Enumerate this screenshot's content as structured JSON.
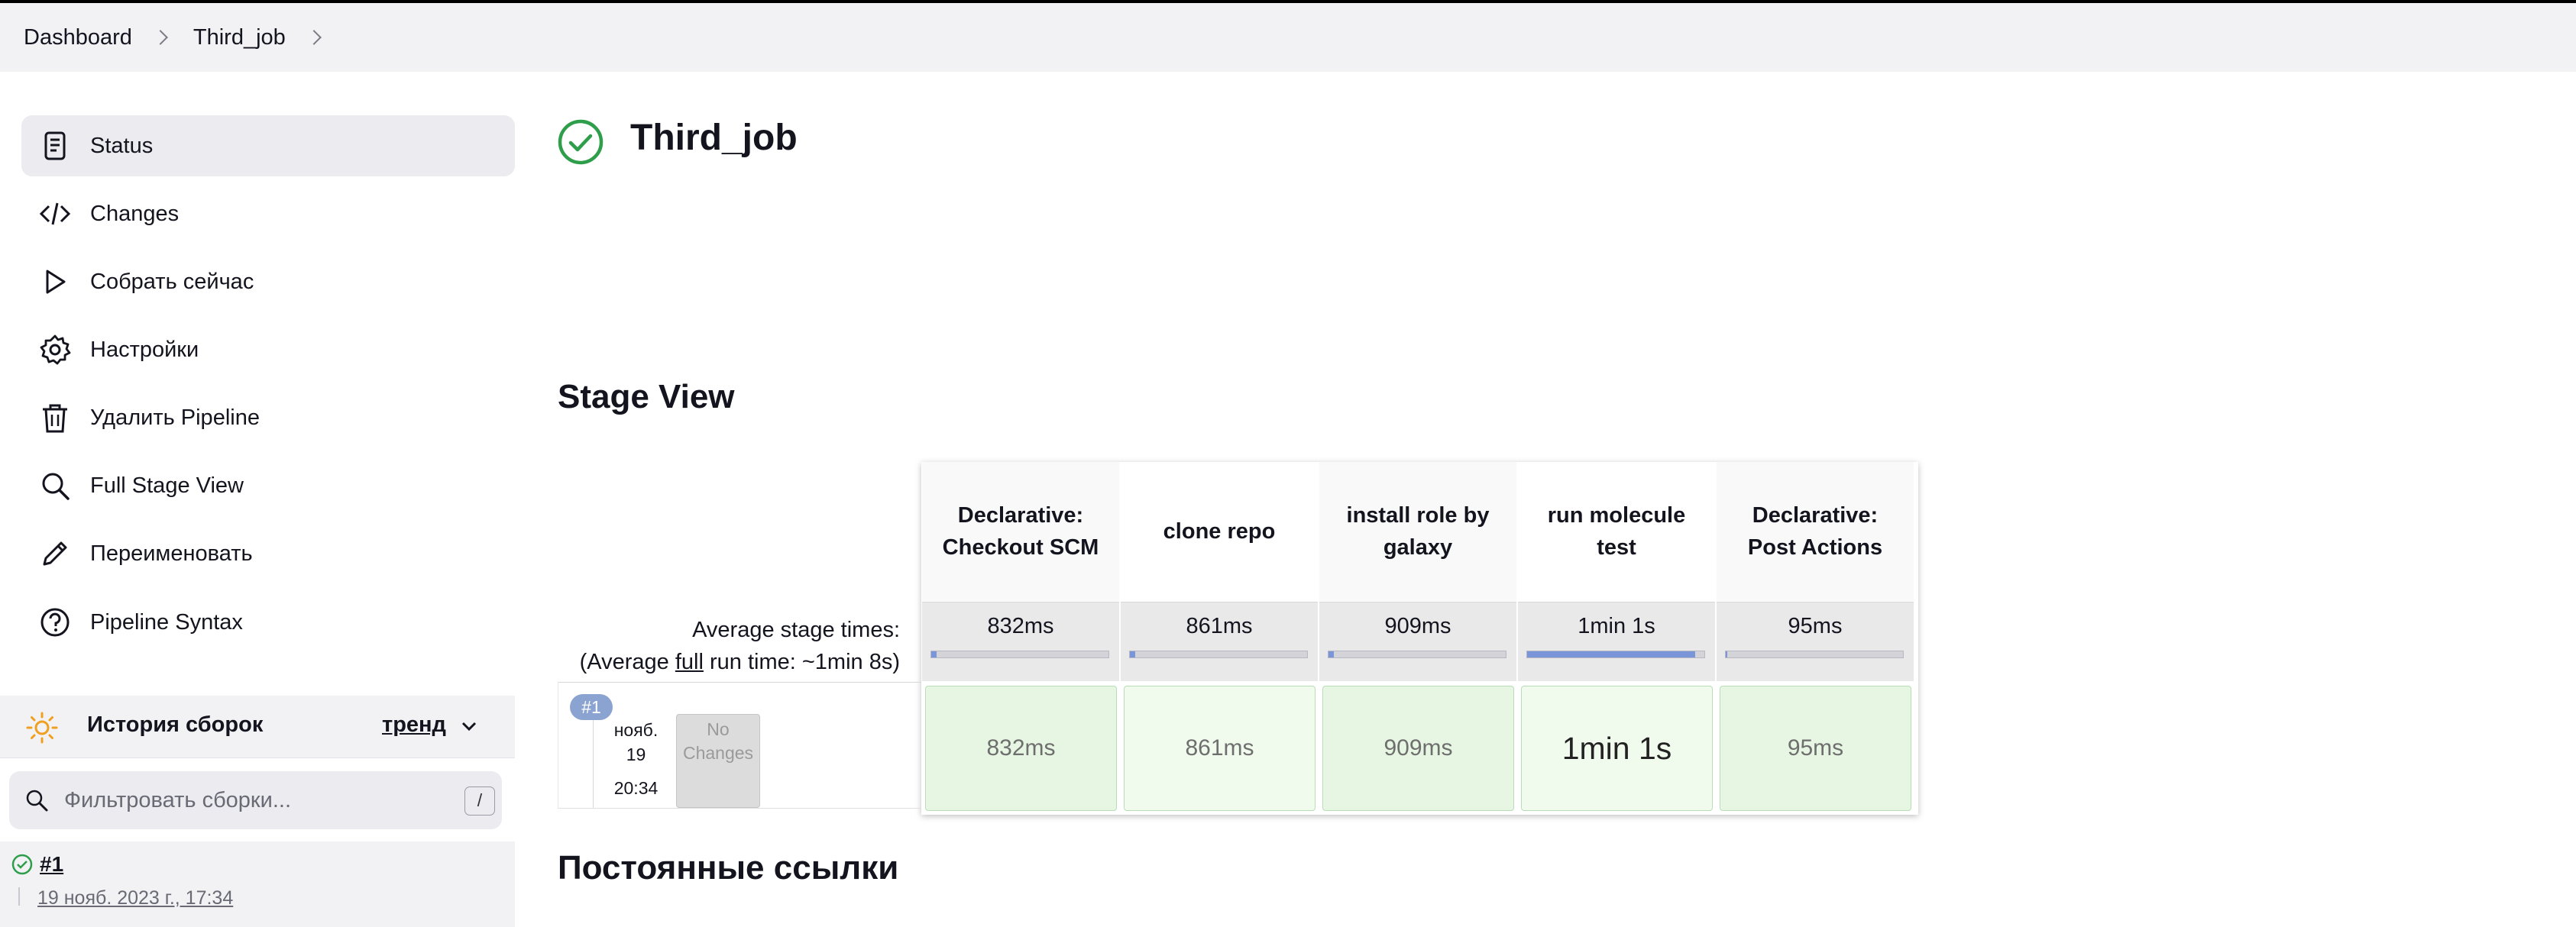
{
  "breadcrumb": {
    "items": [
      "Dashboard",
      "Third_job"
    ]
  },
  "sidebar": {
    "items": [
      {
        "label": "Status",
        "icon": "document-icon"
      },
      {
        "label": "Changes",
        "icon": "code-icon"
      },
      {
        "label": "Собрать сейчас",
        "icon": "play-icon"
      },
      {
        "label": "Настройки",
        "icon": "gear-icon"
      },
      {
        "label": "Удалить Pipeline",
        "icon": "trash-icon"
      },
      {
        "label": "Full Stage View",
        "icon": "search-icon"
      },
      {
        "label": "Переименовать",
        "icon": "pencil-icon"
      },
      {
        "label": "Pipeline Syntax",
        "icon": "help-icon"
      }
    ],
    "history": {
      "title": "История сборок",
      "trend": "тренд",
      "filter_placeholder": "Фильтровать сборки...",
      "filter_shortcut": "/",
      "builds": [
        {
          "number": "#1",
          "date": "19 нояб. 2023 г., 17:34",
          "status": "success"
        }
      ]
    }
  },
  "main": {
    "title": "Third_job",
    "status_color": "#2e9e4a",
    "stage_view": {
      "heading": "Stage View",
      "avg_label_line1": "Average stage times:",
      "avg_label_pre": "(Average ",
      "avg_label_link": "full",
      "avg_label_post": " run time: ~1min 8s)",
      "stages": [
        {
          "name": "Declarative: Checkout SCM",
          "avg": "832ms",
          "run": "832ms",
          "avg_fraction": 0.03
        },
        {
          "name": "clone repo",
          "avg": "861ms",
          "run": "861ms",
          "avg_fraction": 0.03
        },
        {
          "name": "install role by galaxy",
          "avg": "909ms",
          "run": "909ms",
          "avg_fraction": 0.03
        },
        {
          "name": "run molecule test",
          "avg": "1min 1s",
          "run": "1min 1s",
          "avg_fraction": 0.95
        },
        {
          "name": "Declarative: Post Actions",
          "avg": "95ms",
          "run": "95ms",
          "avg_fraction": 0.01
        }
      ],
      "build": {
        "badge": "#1",
        "month": "нояб.",
        "day": "19",
        "time": "20:34",
        "no_changes": "No Changes"
      }
    },
    "permalinks_heading": "Постоянные ссылки"
  }
}
